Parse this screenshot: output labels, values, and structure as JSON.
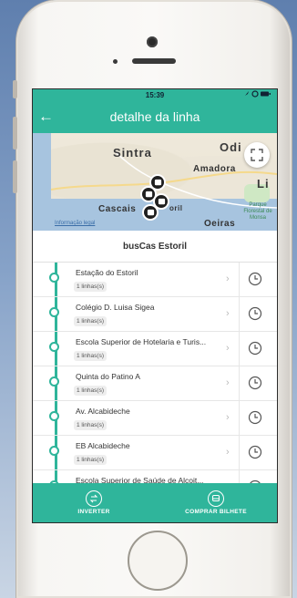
{
  "status_bar": {
    "time": "15:39",
    "icons": [
      "location-arrow-icon",
      "alarm-icon",
      "battery-icon"
    ]
  },
  "nav": {
    "title": "detalhe da linha",
    "back_icon": "arrow-left-icon"
  },
  "map": {
    "labels": {
      "sintra": "Sintra",
      "amadora": "Amadora",
      "odi": "Odi",
      "cascais": "Cascais",
      "oril": "oril",
      "oeiras": "Oeiras",
      "li": "Li",
      "parque": "Parque Florestal de Monsa"
    },
    "legal_link": "Informação legal",
    "expand_icon": "expand-icon"
  },
  "route": {
    "title": "busCas Estoril"
  },
  "stops": [
    {
      "name": "Estação do Estoril",
      "lines": "1 linhas(s)"
    },
    {
      "name": "Colégio D. Luisa Sigea",
      "lines": "1 linhas(s)"
    },
    {
      "name": "Escola Superior de Hotelaria e Turis...",
      "lines": "1 linhas(s)"
    },
    {
      "name": "Quinta do Patino A",
      "lines": "1 linhas(s)"
    },
    {
      "name": "Av. Alcabideche",
      "lines": "1 linhas(s)"
    },
    {
      "name": "EB Alcabideche",
      "lines": "1 linhas(s)"
    },
    {
      "name": "Escola Superior de Saúde de Alcoit...",
      "lines": ""
    }
  ],
  "bottom_bar": {
    "invert_label": "INVERTER",
    "buy_label": "COMPRAR BILHETE"
  },
  "colors": {
    "primary": "#2fb59b",
    "sea": "#a7c4df",
    "land": "#ebe5d6"
  }
}
